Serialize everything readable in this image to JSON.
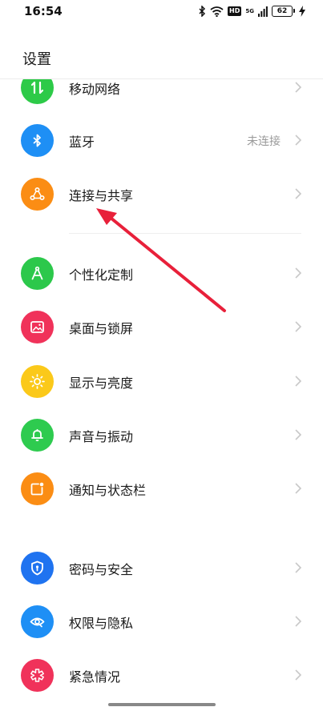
{
  "status_bar": {
    "time": "16:54",
    "hd": "HD",
    "network": "5G",
    "battery": "62",
    "icons": [
      "bluetooth-icon",
      "wifi-icon",
      "signal-icon",
      "charging-icon"
    ]
  },
  "header": {
    "title": "设置"
  },
  "groups": [
    {
      "items": [
        {
          "key": "mobile",
          "label": "移动网络",
          "value": "",
          "icon": "mobile-data-icon",
          "color": "#2dca48"
        },
        {
          "key": "bluetooth",
          "label": "蓝牙",
          "value": "未连接",
          "icon": "bluetooth-icon",
          "color": "#1e8ff5"
        },
        {
          "key": "connect",
          "label": "连接与共享",
          "value": "",
          "icon": "connection-share-icon",
          "color": "#fb8d14"
        }
      ]
    },
    {
      "items": [
        {
          "key": "personal",
          "label": "个性化定制",
          "value": "",
          "icon": "compass-icon",
          "color": "#2cc84b"
        },
        {
          "key": "desktop",
          "label": "桌面与锁屏",
          "value": "",
          "icon": "picture-icon",
          "color": "#f0325a"
        },
        {
          "key": "display",
          "label": "显示与亮度",
          "value": "",
          "icon": "sun-icon",
          "color": "#fbc91a"
        },
        {
          "key": "sound",
          "label": "声音与振动",
          "value": "",
          "icon": "bell-icon",
          "color": "#2ecb4f"
        },
        {
          "key": "notify",
          "label": "通知与状态栏",
          "value": "",
          "icon": "notification-icon",
          "color": "#fb8d14"
        }
      ]
    },
    {
      "items": [
        {
          "key": "password",
          "label": "密码与安全",
          "value": "",
          "icon": "shield-icon",
          "color": "#1f73f0"
        },
        {
          "key": "privacy",
          "label": "权限与隐私",
          "value": "",
          "icon": "eye-icon",
          "color": "#1e8ff5"
        },
        {
          "key": "emergency",
          "label": "紧急情况",
          "value": "",
          "icon": "emergency-icon",
          "color": "#f0325a"
        }
      ]
    }
  ],
  "annotation": {
    "color": "#e8203a"
  }
}
